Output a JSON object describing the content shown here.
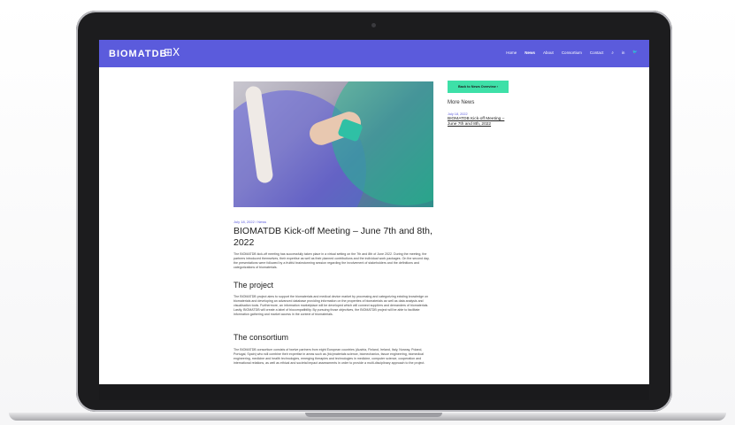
{
  "site": {
    "logo": "BIOMATDB",
    "logo_mark_icon": "biomatdb-mark-icon",
    "nav": [
      "Home",
      "News",
      "About",
      "Consortium",
      "Contact"
    ],
    "active_nav": "News",
    "icons": [
      "search-icon",
      "linkedin-icon",
      "twitter-icon"
    ],
    "accent": "#5b5bdc",
    "button_color": "#3ee0a8"
  },
  "article": {
    "meta": "July 18, 2022 / News",
    "title": "BIOMATDB Kick-off Meeting – June 7th and 8th, 2022",
    "intro": "The BIOMATDB kick-off meeting has successfully taken place in a virtual setting on the 7th and 8th of June 2022. During the meeting, the partners introduced themselves, their expertise as well as their planned contributions and the individual work packages. On the second day, the presentations were followed by a fruitful brainstorming session regarding the involvement of stakeholders and the definitions and categorizations of biomaterials.",
    "section1_title": "The project",
    "section1_text": "The BIOMATDB project aims to support the biomaterials and medical device market by processing and categorizing existing knowledge on biomaterials and developing an advanced database providing information on the properties of biomaterials as well as data analysis and visualisation tools. Furthermore, an information marketplace will be developed which will connect suppliers and demanders of biomaterials. Lastly, BIOMATDB will create a label of biocompatibility. By pursuing those objectives, the BIOMATDB project will be able to facilitate information gathering and market access in the context of biomaterials.",
    "section2_title": "The consortium",
    "section2_text": "The BIOMATDB consortium consists of twelve partners from eight European countries (Austria, Finland, Ireland, Italy, Norway, Poland, Portugal, Spain) who will combine their expertise in areas such as (bio)materials science, biomechanics, tissue engineering, biomedical engineering, medicine and health technologies, emerging therapies and technologies in medicine, computer science, cooperation and international relations, as well as ethical and societal impact assessments in order to provide a multi-disciplinary approach to the project."
  },
  "sidebar": {
    "back_button": "Back to News Overview",
    "more_title": "More News",
    "item_date": "July 18, 2022",
    "item_title": "BIOMATDB Kick-off Meeting – June 7th and 8th, 2022"
  }
}
